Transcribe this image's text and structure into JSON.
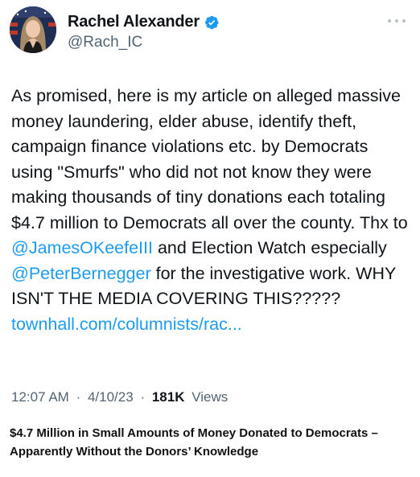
{
  "author": {
    "name": "Rachel Alexander",
    "handle": "@Rach_IC",
    "verified": true,
    "avatar_icon": "profile-photo"
  },
  "tweet": {
    "segments": [
      {
        "type": "text",
        "value": "As promised, here is my article on alleged massive money laundering, elder abuse, identify theft, campaign finance violations etc. by Democrats using \"Smurfs\" who did not not know they were making thousands of tiny donations each totaling $4.7 million  to Democrats all over the county. Thx to "
      },
      {
        "type": "mention",
        "value": "@JamesOKeefeIII"
      },
      {
        "type": "text",
        "value": " and Election Watch especially "
      },
      {
        "type": "mention",
        "value": "@PeterBernegger"
      },
      {
        "type": "text",
        "value": " for the investigative work. WHY ISN'T THE MEDIA COVERING THIS????? "
      },
      {
        "type": "link",
        "value": "townhall.com/columnists/rac..."
      }
    ]
  },
  "meta": {
    "time": "12:07 AM",
    "separator": "·",
    "date": "4/10/23",
    "views_count": "181K",
    "views_label": "Views"
  },
  "caption": "$4.7 Million in Small Amounts of Money Donated to Democrats – Apparently Without the Donors’ Knowledge",
  "colors": {
    "link": "#1d9bf0",
    "verified": "#1d9bf0",
    "secondary_text": "#536471"
  }
}
